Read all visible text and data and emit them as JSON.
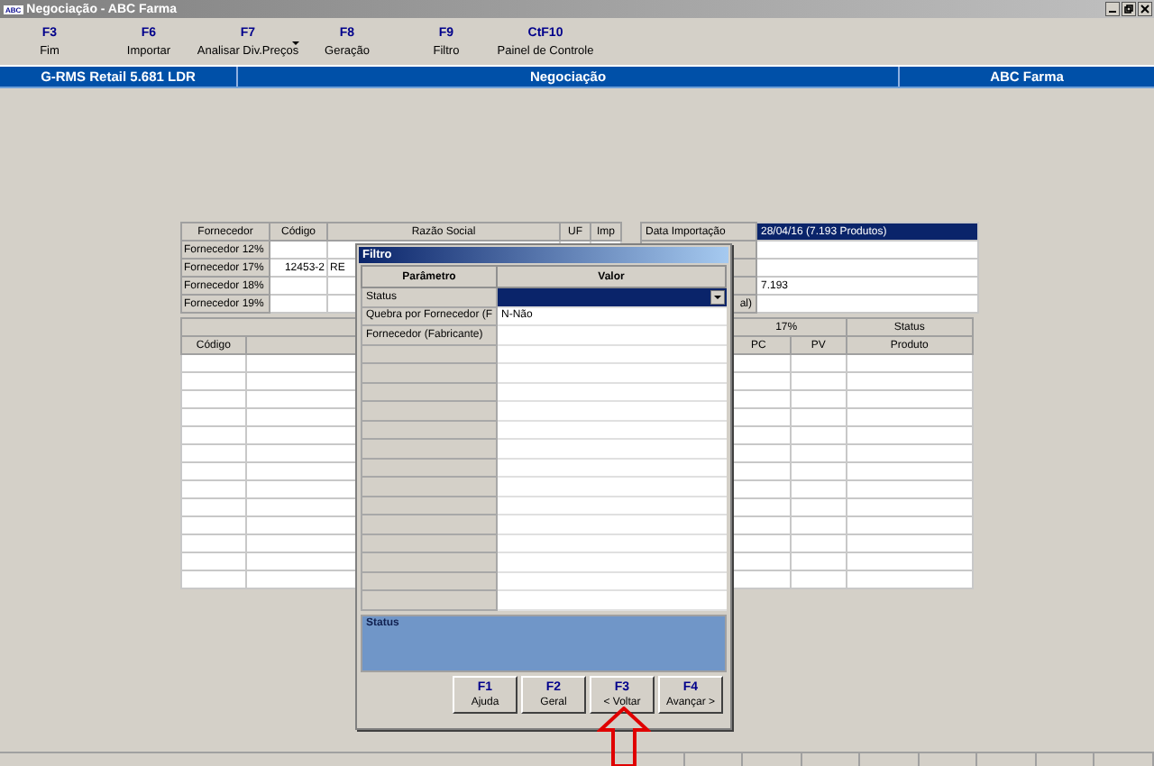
{
  "window": {
    "title": "Negociação - ABC Farma",
    "app_icon": "ABC"
  },
  "toolbar": [
    {
      "key": "F3",
      "label": "Fim",
      "dropdown": false
    },
    {
      "key": "F6",
      "label": "Importar",
      "dropdown": false
    },
    {
      "key": "F7",
      "label": "Analisar Div.Preços",
      "dropdown": true
    },
    {
      "key": "F8",
      "label": "Geração",
      "dropdown": false
    },
    {
      "key": "F9",
      "label": "Filtro",
      "dropdown": false
    },
    {
      "key": "CtF10",
      "label": "Painel de Controle",
      "dropdown": false
    }
  ],
  "header_bar": [
    "G-RMS Retail 5.681 LDR",
    "Negociação",
    "ABC Farma"
  ],
  "supplier_grid": {
    "columns": [
      "Fornecedor",
      "Código",
      "Razão Social",
      "UF",
      "Imp"
    ],
    "rows": [
      {
        "fornecedor": "Fornecedor 12%"
      },
      {
        "fornecedor": "Fornecedor 17%",
        "codigo": "12453-2",
        "razao_social": "RE"
      },
      {
        "fornecedor": "Fornecedor 18%"
      },
      {
        "fornecedor": "Fornecedor 19%"
      }
    ]
  },
  "import_panel": {
    "label": "Data Importação",
    "value": "28/04/16   (7.193 Produtos)",
    "count": "7.193",
    "last_label": "al)"
  },
  "product_grid": {
    "group_headers": [
      "17%",
      "Status"
    ],
    "columns": [
      "Código",
      "PC",
      "PV",
      "Produto"
    ]
  },
  "filter_dialog": {
    "title": "Filtro",
    "columns": [
      "Parâmetro",
      "Valor"
    ],
    "rows": [
      {
        "parameter": "Status",
        "selected": true
      },
      {
        "parameter": "Quebra por Fornecedor (F",
        "value": "N-Não",
        "selected": false
      },
      {
        "parameter": "Fornecedor (Fabricante)",
        "selected": false
      }
    ],
    "status_label": "Status",
    "buttons": [
      {
        "key": "F1",
        "label": "Ajuda"
      },
      {
        "key": "F2",
        "label": "Geral"
      },
      {
        "key": "F3",
        "label": "< Voltar"
      },
      {
        "key": "F4",
        "label": "Avançar >"
      }
    ]
  }
}
